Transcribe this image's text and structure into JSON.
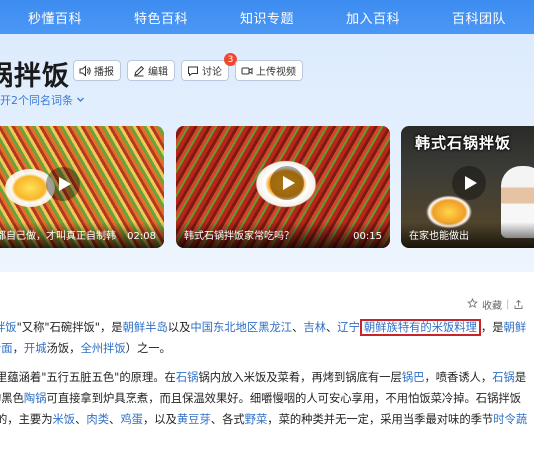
{
  "nav": {
    "items": [
      "秒懂百科",
      "特色百科",
      "知识专题",
      "加入百科",
      "百科团队"
    ]
  },
  "header": {
    "title": "锅拌饭",
    "actions": [
      {
        "label": "播报",
        "icon": "speaker-icon"
      },
      {
        "label": "编辑",
        "icon": "edit-icon"
      },
      {
        "label": "讨论",
        "icon": "comment-icon",
        "badge": "3"
      },
      {
        "label": "上传视频",
        "icon": "video-icon"
      }
    ],
    "expand_text": "开2个同名词条"
  },
  "videos": [
    {
      "caption": "都自己做，才叫真正自制韩",
      "duration": "02:08"
    },
    {
      "caption": "韩式石锅拌饭家常吃吗？",
      "duration": "00:15"
    },
    {
      "caption": "在家也能做出",
      "title_overlay": "韩式石锅拌饭",
      "duration": ""
    }
  ],
  "toolbar": {
    "favorite": "收藏"
  },
  "article": {
    "p1": {
      "a": "拌饭",
      "b": "\"又称\"石碗拌饭\"，是",
      "c": "朝鲜半岛",
      "d": "以及",
      "e": "中国东北地区黑龙江",
      "f": "、",
      "g": "吉林",
      "h": "、",
      "i": "辽宁",
      "j": "朝鲜族特有的米饭料理",
      "k": "，是",
      "l": "朝鲜"
    },
    "p2": {
      "a": "冷面",
      "b": "，",
      "c": "开城",
      "d": "汤饭，",
      "e": "全州拌饭",
      "f": "）之一。"
    },
    "p3": {
      "a": "里蕴涵着\"五行五脏五色\"的原理。在",
      "b": "石锅",
      "c": "锅内放入米饭及菜肴，再烤到锅底有一层",
      "d": "锅巴",
      "e": "，喷香诱人，",
      "f": "石锅",
      "g": "是"
    },
    "p4": {
      "a": "的黑色",
      "b": "陶锅",
      "c": "可直接拿到炉具烹煮，而且保温效果好。细嚼慢咽的人可安心享用，不用怕饭菜冷掉。石锅拌饭"
    },
    "p5": {
      "a": "的，主要为",
      "b": "米饭",
      "c": "、",
      "d": "肉类",
      "e": "、",
      "f": "鸡蛋",
      "g": "，以及",
      "h": "黄豆芽",
      "i": "、各式",
      "j": "野菜",
      "k": "，菜的种类并无一定，采用当季最对味的季节",
      "l": "时令蔬"
    }
  },
  "colors": {
    "nav_bg": "#4392f3",
    "link": "#2f6fc6",
    "highlight_border": "#c8242a",
    "badge": "#f0472f"
  }
}
